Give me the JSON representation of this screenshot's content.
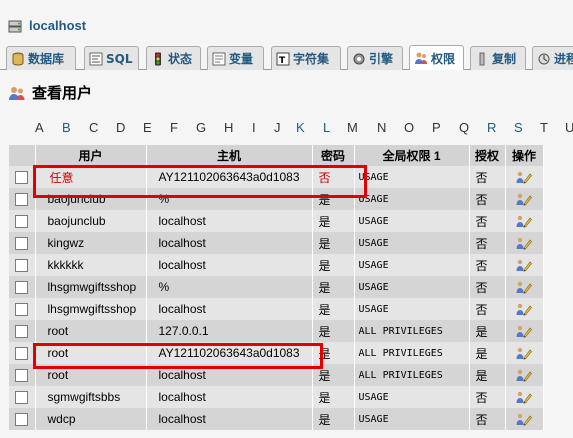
{
  "server": {
    "name": "localhost"
  },
  "tabs": [
    {
      "label": "数据库",
      "icon": "database-icon"
    },
    {
      "label": "SQL",
      "icon": "sql-icon"
    },
    {
      "label": "状态",
      "icon": "status-icon"
    },
    {
      "label": "变量",
      "icon": "variables-icon"
    },
    {
      "label": "字符集",
      "icon": "charset-icon"
    },
    {
      "label": "引擎",
      "icon": "engine-icon"
    },
    {
      "label": "权限",
      "icon": "privileges-icon"
    },
    {
      "label": "复制",
      "icon": "replication-icon"
    },
    {
      "label": "进程",
      "icon": "process-icon"
    }
  ],
  "page": {
    "title": "查看用户"
  },
  "letters": [
    "A",
    "B",
    "C",
    "D",
    "E",
    "F",
    "G",
    "H",
    "I",
    "J",
    "K",
    "L",
    "M",
    "N",
    "O",
    "P",
    "Q",
    "R",
    "S",
    "T",
    "U"
  ],
  "table": {
    "headers": {
      "user": "用户",
      "host": "主机",
      "password": "密码",
      "global": "全局权限 1",
      "grant": "授权",
      "action": "操作"
    },
    "rows": [
      {
        "user": "任意",
        "host": "AY121102063643a0d1083",
        "password": "否",
        "priv": "USAGE",
        "grant": "否"
      },
      {
        "user": "baojunclub",
        "host": "%",
        "password": "是",
        "priv": "USAGE",
        "grant": "否"
      },
      {
        "user": "baojunclub",
        "host": "localhost",
        "password": "是",
        "priv": "USAGE",
        "grant": "否"
      },
      {
        "user": "kingwz",
        "host": "localhost",
        "password": "是",
        "priv": "USAGE",
        "grant": "否"
      },
      {
        "user": "kkkkkk",
        "host": "localhost",
        "password": "是",
        "priv": "USAGE",
        "grant": "否"
      },
      {
        "user": "lhsgmwgiftsshop",
        "host": "%",
        "password": "是",
        "priv": "USAGE",
        "grant": "否"
      },
      {
        "user": "lhsgmwgiftsshop",
        "host": "localhost",
        "password": "是",
        "priv": "USAGE",
        "grant": "否"
      },
      {
        "user": "root",
        "host": "127.0.0.1",
        "password": "是",
        "priv": "ALL PRIVILEGES",
        "grant": "是"
      },
      {
        "user": "root",
        "host": "AY121102063643a0d1083",
        "password": "是",
        "priv": "ALL PRIVILEGES",
        "grant": "是"
      },
      {
        "user": "root",
        "host": "localhost",
        "password": "是",
        "priv": "ALL PRIVILEGES",
        "grant": "是"
      },
      {
        "user": "sgmwgiftsbbs",
        "host": "localhost",
        "password": "是",
        "priv": "USAGE",
        "grant": "否"
      },
      {
        "user": "wdcp",
        "host": "localhost",
        "password": "是",
        "priv": "USAGE",
        "grant": "否"
      }
    ]
  },
  "colors": {
    "link": "#235a81",
    "highlight": "#e00000",
    "anonymous_text": "#cc0000"
  }
}
